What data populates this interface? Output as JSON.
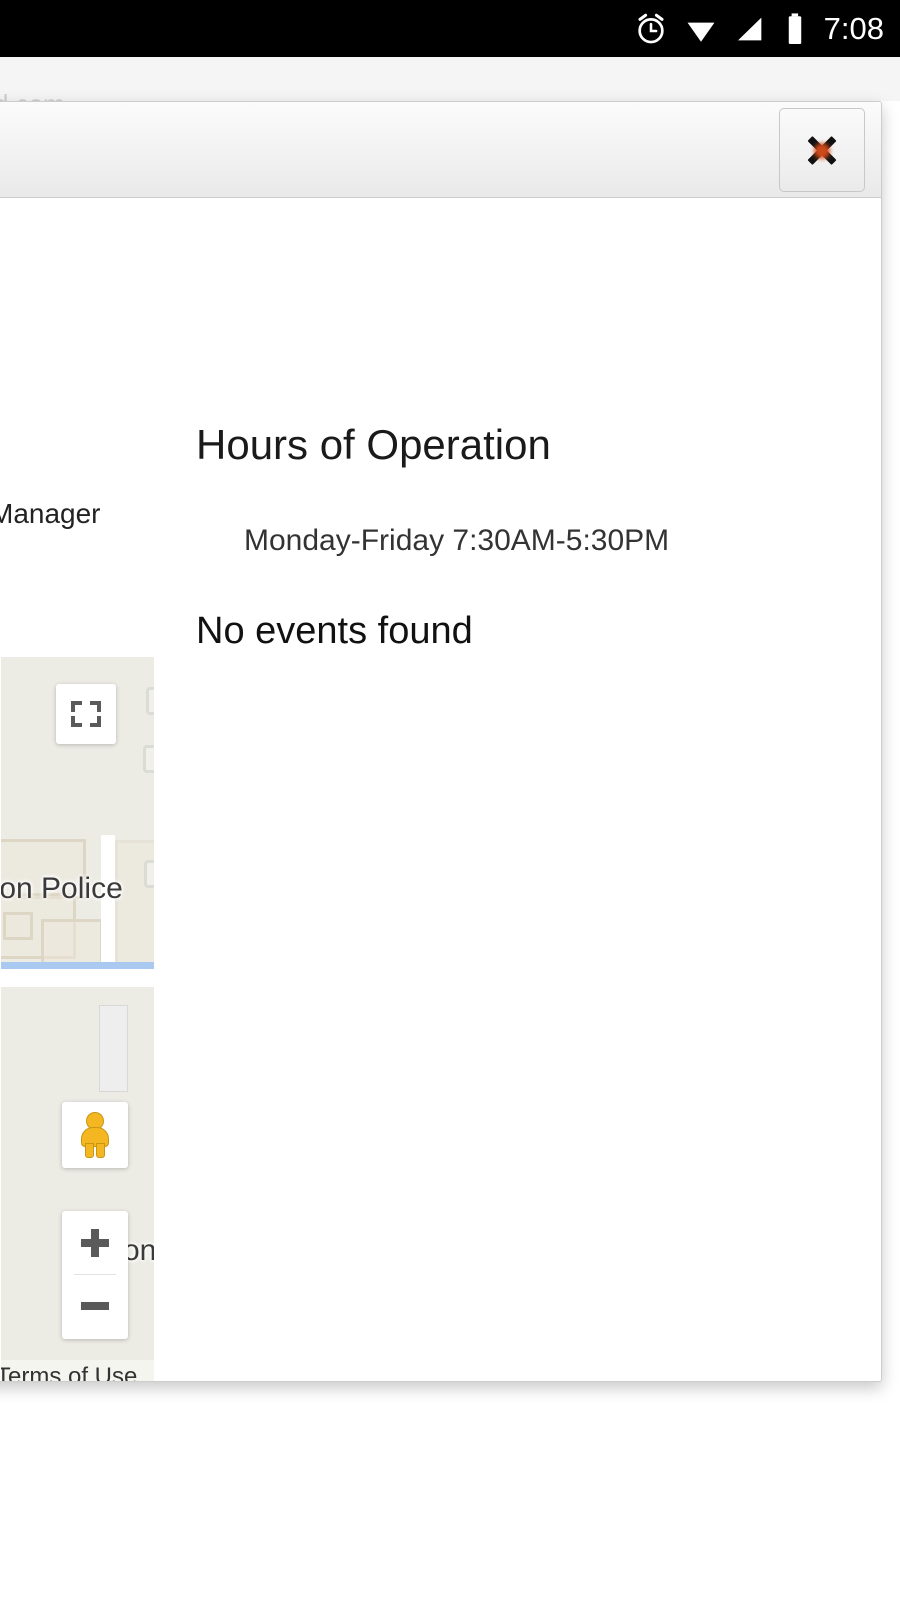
{
  "statusbar": {
    "time": "7:08",
    "icons": [
      "alarm-clock-icon",
      "wifi-icon",
      "cellular-signal-icon",
      "battery-icon"
    ]
  },
  "browser": {
    "url_fragment": "d.com"
  },
  "dialog": {
    "close_label": "✖",
    "close_name": "close-dialog-button"
  },
  "content": {
    "title": "Hours of Operation",
    "hours": "Monday-Friday 7:30AM-5:30PM",
    "events_status": "No events found",
    "manager_label": "Manager"
  },
  "map": {
    "label_police": "ton Police",
    "label_partial": "on",
    "terms": "Terms of Use",
    "controls": {
      "fullscreen": "fullscreen-icon",
      "pegman": "street-view-pegman-icon",
      "zoom_in": "+",
      "zoom_out": "−"
    },
    "colors": {
      "background": "#ecebe4",
      "building_outline": "#ded6c4",
      "road_white": "#ffffff",
      "water_blue": "#a9c9f0",
      "pegman": "#f5b721"
    }
  }
}
